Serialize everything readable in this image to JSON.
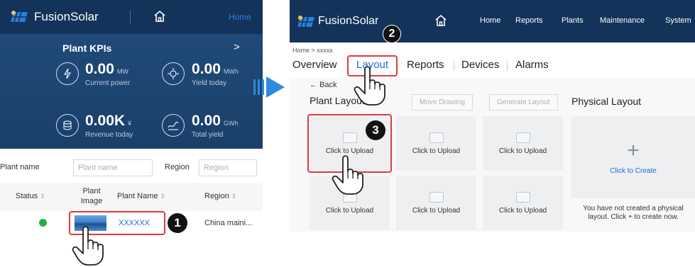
{
  "left": {
    "brand": "FusionSolar",
    "home": "Home",
    "kpi_title": "Plant KPIs",
    "kpi_arrow": ">",
    "kpis": [
      {
        "value": "0.00",
        "unit": "MW",
        "label": "Current power",
        "icon": "power-icon"
      },
      {
        "value": "0.00",
        "unit": "MWh",
        "label": "Yield today",
        "icon": "yield-today-icon"
      },
      {
        "value": "0.00K",
        "unit": "¥",
        "label": "Revenue today",
        "icon": "revenue-icon"
      },
      {
        "value": "0.00",
        "unit": "GWh",
        "label": "Total yield",
        "icon": "total-yield-icon"
      }
    ],
    "filter": {
      "plant_name_label": "Plant name",
      "plant_name_placeholder": "Plant name",
      "region_label": "Region",
      "region_placeholder": "Region"
    },
    "table": {
      "headers": [
        "Status",
        "Plant Image",
        "Plant Name",
        "Region"
      ],
      "plant_image_line1": "Plant",
      "plant_image_line2": "Image",
      "row": {
        "name": "XXXXXX",
        "region": "China maini..."
      }
    },
    "step": "1"
  },
  "right": {
    "brand": "FusionSolar",
    "nav": [
      "Home",
      "Reports",
      "Plants",
      "Maintenance",
      "System"
    ],
    "step2": "2",
    "breadcrumb": "Home > xxxxx",
    "tabs": [
      "Overview",
      "Layout",
      "Reports",
      "Devices",
      "Alarms"
    ],
    "back": "← Back",
    "plant_layout": "Plant Layout",
    "move_drawing": "Move Drawing",
    "generate_layout": "Generate Layout",
    "physical_layout": "Physical Layout",
    "upload": "Click to Upload",
    "create_plus": "+",
    "create": "Click to Create",
    "empty_note_1": "You have not created a physical",
    "empty_note_2": "layout. Click + to create now.",
    "step3": "3"
  },
  "colors": {
    "topbar": "#13335a",
    "kpi_bg": "#1f4a78",
    "accent": "#1a6dd1",
    "highlight": "#e0393e",
    "status_ok": "#22b14c"
  }
}
